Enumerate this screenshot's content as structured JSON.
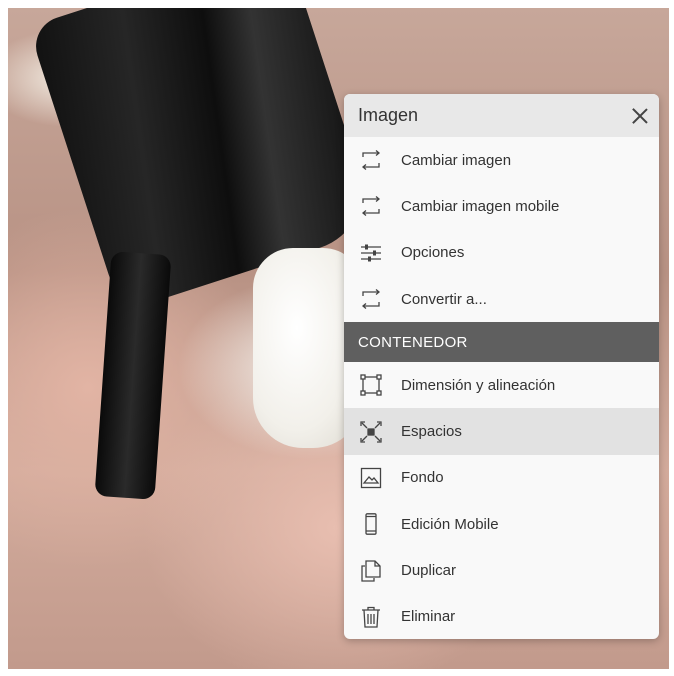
{
  "menu": {
    "title": "Imagen",
    "items_top": [
      {
        "label": "Cambiar imagen",
        "icon": "swap-icon"
      },
      {
        "label": "Cambiar imagen mobile",
        "icon": "swap-icon"
      },
      {
        "label": "Opciones",
        "icon": "sliders-icon"
      },
      {
        "label": "Convertir a...",
        "icon": "swap-icon"
      }
    ],
    "section_label": "CONTENEDOR",
    "items_bottom": [
      {
        "label": "Dimensión y alineación",
        "icon": "dimension-icon"
      },
      {
        "label": "Espacios",
        "icon": "spacing-icon",
        "active": true
      },
      {
        "label": "Fondo",
        "icon": "image-icon"
      },
      {
        "label": "Edición Mobile",
        "icon": "mobile-icon"
      },
      {
        "label": "Duplicar",
        "icon": "duplicate-icon"
      },
      {
        "label": "Eliminar",
        "icon": "trash-icon"
      }
    ]
  },
  "colors": {
    "header_bg": "#e8e8e8",
    "section_bg": "#5f5f5f",
    "active_bg": "#e2e2e2"
  }
}
